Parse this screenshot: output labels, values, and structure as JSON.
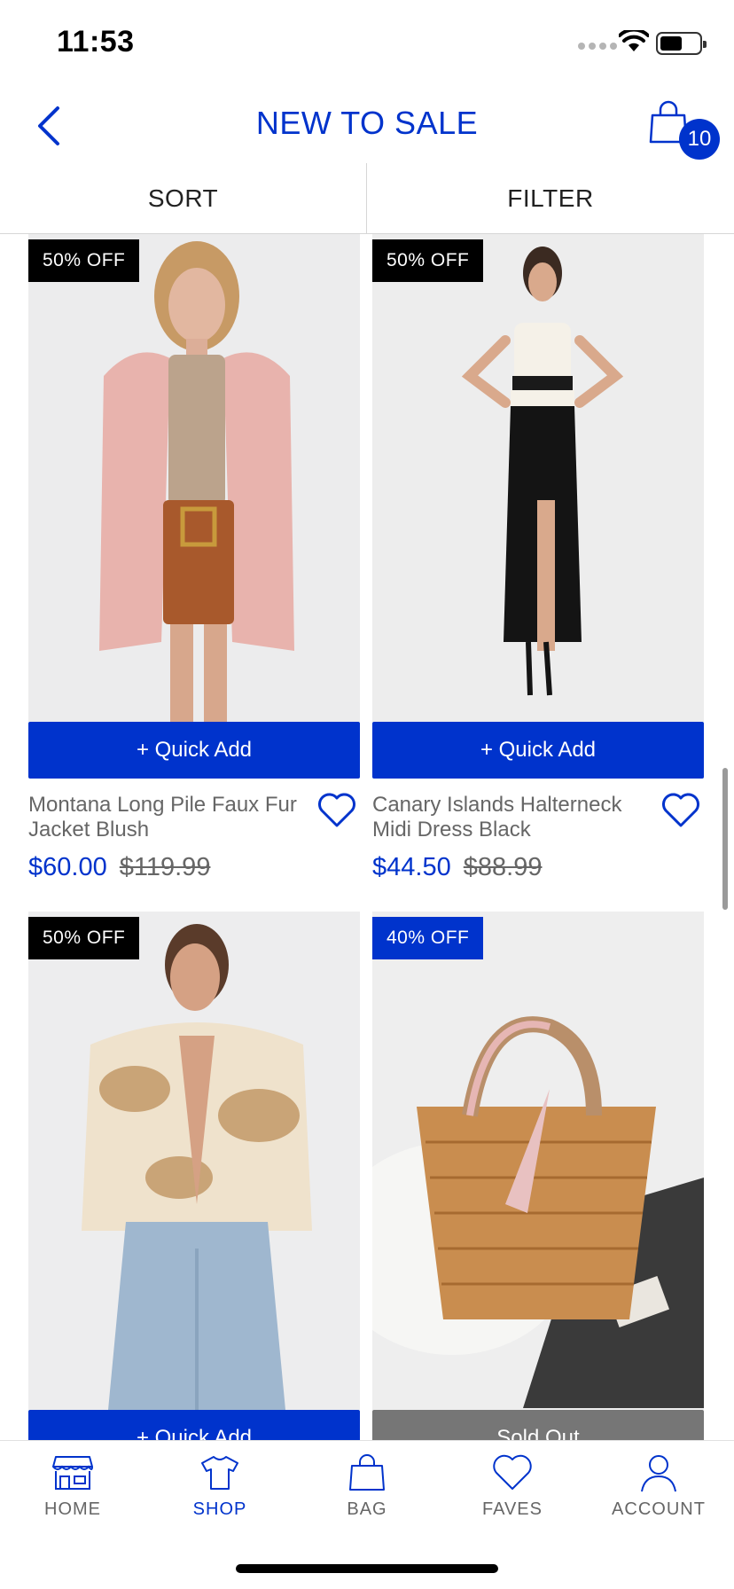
{
  "status_bar": {
    "time": "11:53"
  },
  "header": {
    "title": "NEW TO SALE",
    "bag_count": "10"
  },
  "toolbar": {
    "sort_label": "SORT",
    "filter_label": "FILTER"
  },
  "colors": {
    "accent": "#0033cc",
    "badge_black": "#000000",
    "sold_out": "#767676"
  },
  "products": [
    {
      "badge": "50% OFF",
      "badge_color": "#000000",
      "button_label": "+ Quick Add",
      "name": "Montana Long Pile Faux Fur Jacket Blush",
      "sale_price": "$60.00",
      "original_price": "$119.99"
    },
    {
      "badge": "50% OFF",
      "badge_color": "#000000",
      "button_label": "+ Quick Add",
      "name": "Canary Islands Halterneck Midi Dress Black",
      "sale_price": "$44.50",
      "original_price": "$88.99"
    },
    {
      "badge": "50% OFF",
      "badge_color": "#000000",
      "button_label": "+ Quick Add"
    },
    {
      "badge": "40% OFF",
      "badge_color": "#0033cc",
      "button_label": "Sold Out"
    }
  ],
  "tab_bar": {
    "items": [
      {
        "label": "HOME",
        "icon": "store-icon"
      },
      {
        "label": "SHOP",
        "icon": "tshirt-icon",
        "active": true
      },
      {
        "label": "BAG",
        "icon": "bag-icon"
      },
      {
        "label": "FAVES",
        "icon": "heart-icon"
      },
      {
        "label": "ACCOUNT",
        "icon": "person-icon"
      }
    ]
  }
}
